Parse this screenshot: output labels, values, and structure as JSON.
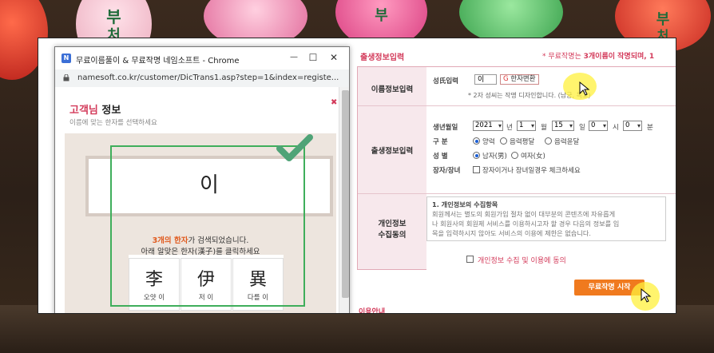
{
  "background": {
    "lanterns": [
      {
        "color": "#d83a2e",
        "char": ""
      },
      {
        "color": "#f2b9c9",
        "char": "부\n처"
      },
      {
        "color": "#f0a0bf",
        "char": ""
      },
      {
        "color": "#e86a9c",
        "char": "부\n처"
      },
      {
        "color": "#5cc46a",
        "char": ""
      },
      {
        "color": "#d8322c",
        "char": "부\n처"
      }
    ]
  },
  "popup": {
    "favicon_letter": "N",
    "window_title": "무료이름풀이 & 무료작명 네임소프트 - Chrome",
    "controls": {
      "minimize": "—",
      "maximize": "☐",
      "close": "✕"
    },
    "url": "namesoft.co.kr/customer/DicTrans1.asp?step=1&index=registe...",
    "title_prefix": "고객님",
    "title_suffix": " 정보",
    "subtitle": "이름에 맞는 한자를 선택하세요",
    "close_mark": "✖",
    "name_display": "이",
    "found_count": "3개의 한자",
    "found_text": "가 검색되었습니다.",
    "click_hint": "아래 알맞은 한자(漢子)를 클릭하세요",
    "hanja_options": [
      {
        "char": "李",
        "meaning": "오얏 이"
      },
      {
        "char": "伊",
        "meaning": "저 이"
      },
      {
        "char": "異",
        "meaning": "다를 이"
      }
    ]
  },
  "form": {
    "section_title": "출생정보입력",
    "notice_prefix": "* 무료작명는 ",
    "notice_bold": "3개이름이 작명되며, 1",
    "name_row": {
      "label": "이름정보입력",
      "field_label": "성氏입력",
      "surname_value": "이",
      "hanja_button": "한자변환",
      "hanja_button_icon": "G",
      "note": "* 2자 성씨는 작명 디자인합니다. (남궁, 독고)"
    },
    "birth_row": {
      "label": "출생정보입력",
      "date_label": "생년월일",
      "year": "2021",
      "year_unit": "년",
      "month": "1",
      "month_unit": "월",
      "day": "15",
      "day_unit": "일",
      "hour": "0",
      "hour_unit": "시",
      "minute": "0",
      "minute_unit": "분",
      "calendar_label": "구  분",
      "calendar_options": [
        "양력",
        "음력평달",
        "음력윤달"
      ],
      "gender_label": "성  별",
      "gender_options": [
        "남자(男)",
        "여자(女)"
      ],
      "twin_label": "장자/장녀",
      "twin_text": "장자이거나 장녀일경우 체크하세요"
    },
    "privacy_row": {
      "label_line1": "개인정보",
      "label_line2": "수집동의",
      "heading": "1. 개인정보의 수집항목",
      "line1": "회원께서는 별도의 회원가입 절차 없이 대부분의 콘텐츠에 자유롭게",
      "line2": "나 회원사의 회원제 서비스를 이용하시고자 할 경우 다음의 정보를 입",
      "line3": "목을 입력하시지 않아도 서비스의 이용에 제한은 없습니다.",
      "agree_text": "개인정보 수집 및 이용에 동의"
    },
    "start_button": "무료작명 시작",
    "usage_link": "이용안내"
  }
}
